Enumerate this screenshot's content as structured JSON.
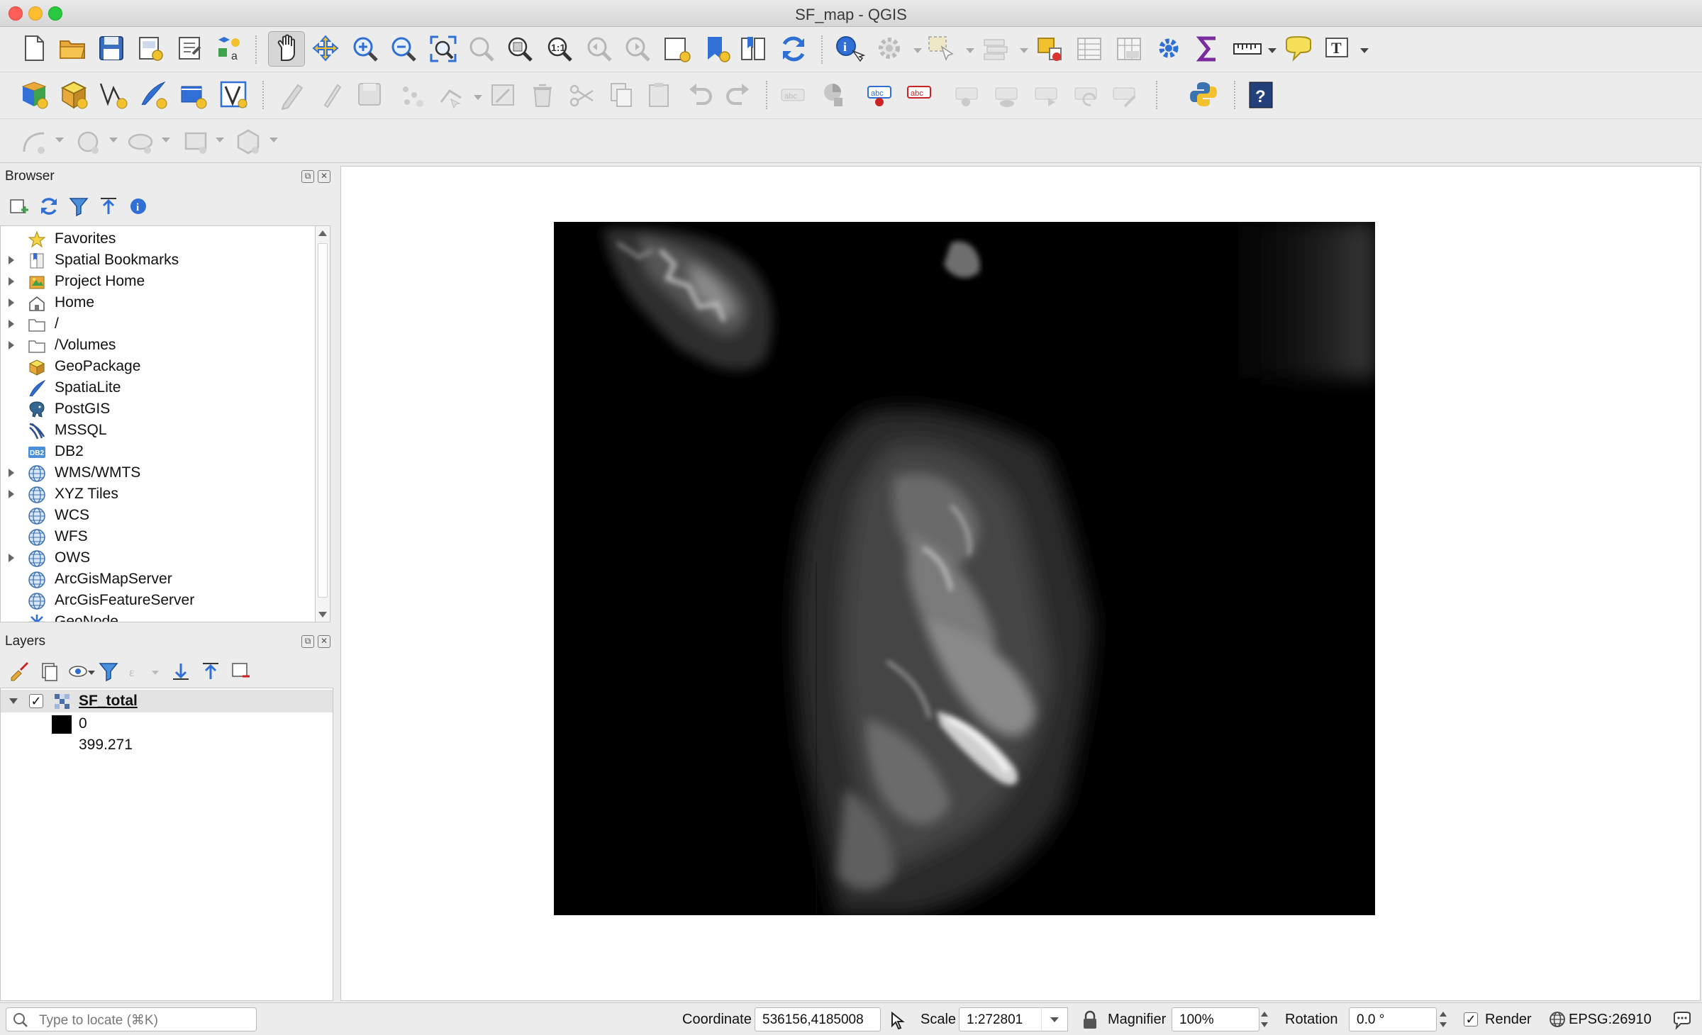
{
  "window": {
    "title": "SF_map - QGIS"
  },
  "browser_panel": {
    "title": "Browser",
    "items": [
      {
        "label": "Favorites",
        "icon": "star-icon",
        "expandable": false
      },
      {
        "label": "Spatial Bookmarks",
        "icon": "bookmark-icon",
        "expandable": true
      },
      {
        "label": "Project Home",
        "icon": "project-home-icon",
        "expandable": true
      },
      {
        "label": "Home",
        "icon": "home-folder-icon",
        "expandable": true
      },
      {
        "label": "/",
        "icon": "folder-icon",
        "expandable": true
      },
      {
        "label": "/Volumes",
        "icon": "folder-icon",
        "expandable": true
      },
      {
        "label": "GeoPackage",
        "icon": "geopackage-icon",
        "expandable": false
      },
      {
        "label": "SpatiaLite",
        "icon": "spatialite-icon",
        "expandable": false
      },
      {
        "label": "PostGIS",
        "icon": "postgis-icon",
        "expandable": false
      },
      {
        "label": "MSSQL",
        "icon": "mssql-icon",
        "expandable": false
      },
      {
        "label": "DB2",
        "icon": "db2-icon",
        "expandable": false
      },
      {
        "label": "WMS/WMTS",
        "icon": "globe-icon",
        "expandable": true
      },
      {
        "label": "XYZ Tiles",
        "icon": "globe-icon",
        "expandable": true
      },
      {
        "label": "WCS",
        "icon": "globe-icon",
        "expandable": false
      },
      {
        "label": "WFS",
        "icon": "globe-icon",
        "expandable": false
      },
      {
        "label": "OWS",
        "icon": "globe-icon",
        "expandable": true
      },
      {
        "label": "ArcGisMapServer",
        "icon": "globe-icon",
        "expandable": false
      },
      {
        "label": "ArcGisFeatureServer",
        "icon": "globe-icon",
        "expandable": false
      },
      {
        "label": "GeoNode",
        "icon": "geonode-icon",
        "expandable": false
      }
    ]
  },
  "layers_panel": {
    "title": "Layers",
    "layer": {
      "name": "SF_total",
      "visible": true,
      "legend_min": "0",
      "legend_max": "399.271"
    }
  },
  "statusbar": {
    "locator_placeholder": "Type to locate (⌘K)",
    "coordinate_label": "Coordinate",
    "coordinate_value": "536156,4185008",
    "scale_label": "Scale",
    "scale_value": "1:272801",
    "magnifier_label": "Magnifier",
    "magnifier_value": "100%",
    "rotation_label": "Rotation",
    "rotation_value": "0.0 °",
    "render_label": "Render",
    "render_checked": true,
    "crs_label": "EPSG:26910"
  },
  "colors": {
    "raster_low": "#000000",
    "raster_high": "#ffffff",
    "accent_blue": "#2f6fd6",
    "accent_yellow": "#f2c12e"
  }
}
